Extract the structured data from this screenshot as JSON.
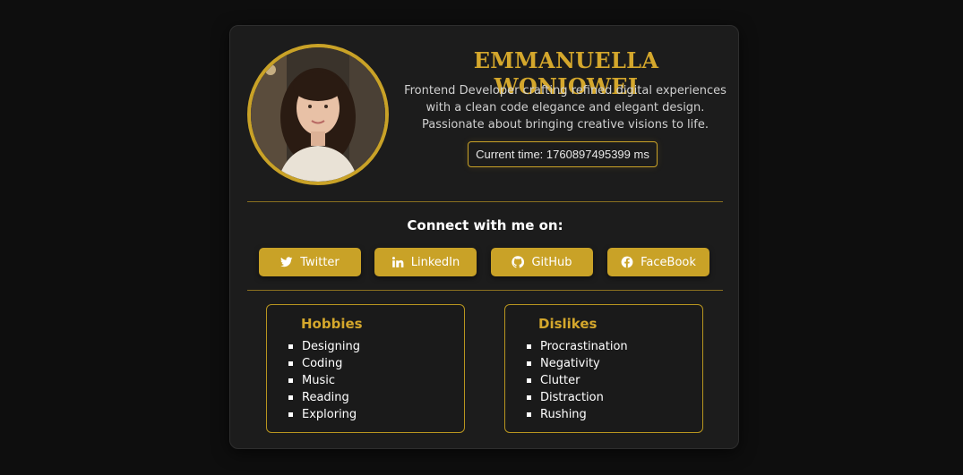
{
  "profile": {
    "name": "EMMANUELLA WONIOWEI",
    "bio": "Frontend Developer crafting refined digital experiences with a clean code elegance and elegant design. Passionate about bringing creative visions to life.",
    "time_text": "Current time: 1760897495399 ms",
    "avatar_alt": "profile photo"
  },
  "connect": {
    "heading": "Connect with me on:",
    "links": [
      {
        "label": "Twitter",
        "icon": "twitter-icon"
      },
      {
        "label": "LinkedIn",
        "icon": "linkedin-icon"
      },
      {
        "label": "GitHub",
        "icon": "github-icon"
      },
      {
        "label": "FaceBook",
        "icon": "facebook-icon"
      }
    ]
  },
  "hobbies": {
    "title": "Hobbies",
    "items": [
      "Designing",
      "Coding",
      "Music",
      "Reading",
      "Exploring"
    ]
  },
  "dislikes": {
    "title": "Dislikes",
    "items": [
      "Procrastination",
      "Negativity",
      "Clutter",
      "Distraction",
      "Rushing"
    ]
  },
  "colors": {
    "accent": "#c9a227",
    "background": "#0e0e0e",
    "card": "#1c1c1c"
  }
}
